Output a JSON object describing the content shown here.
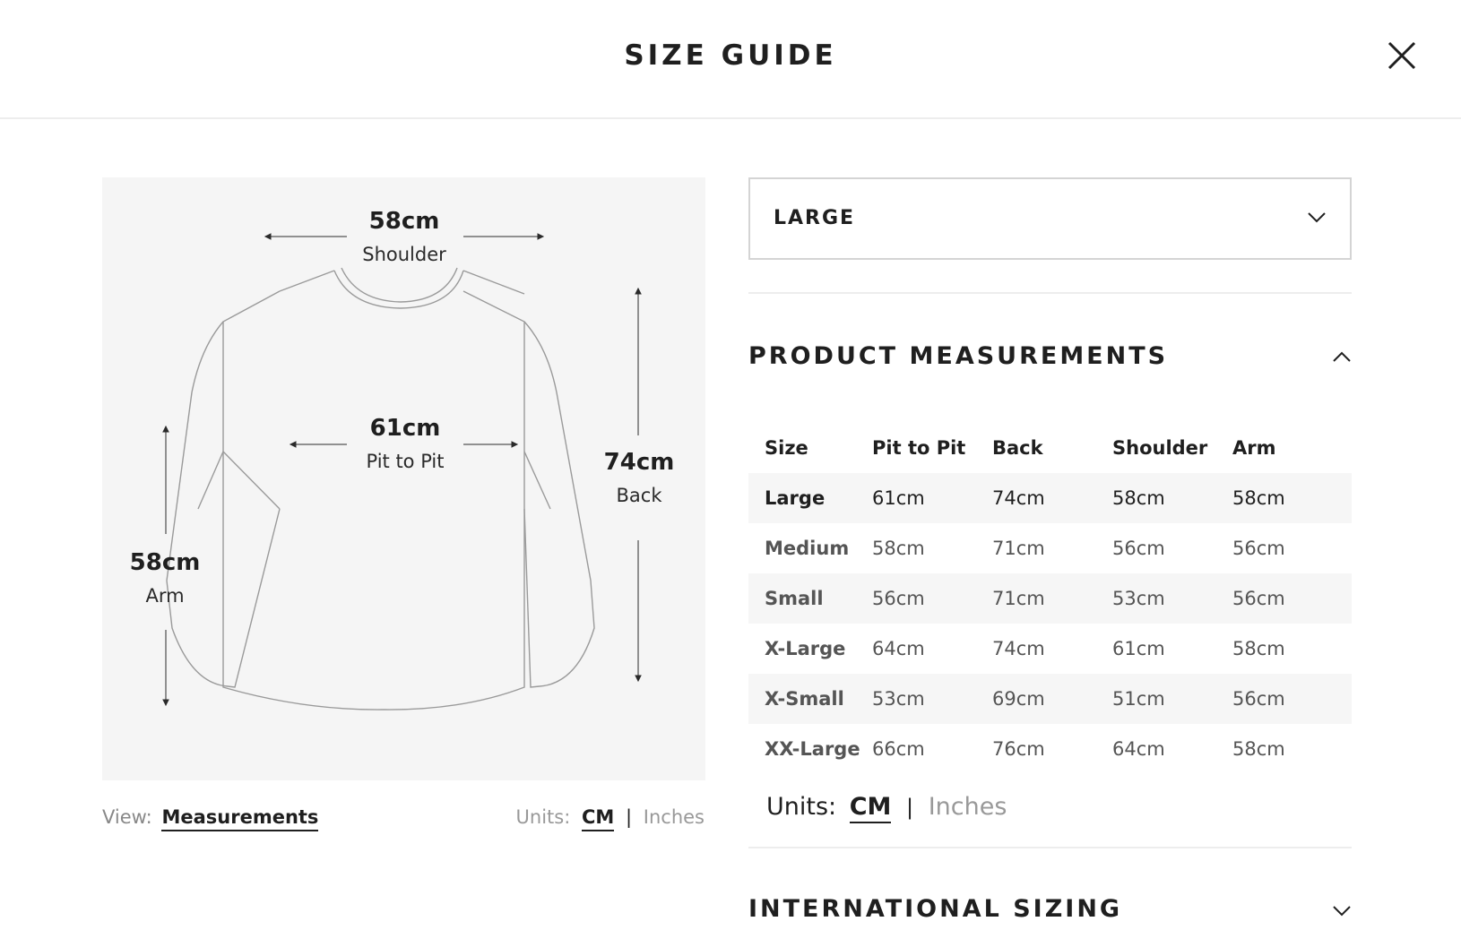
{
  "header": {
    "title": "SIZE GUIDE",
    "close_icon": "close-icon"
  },
  "diagram": {
    "shoulder": {
      "value": "58cm",
      "label": "Shoulder"
    },
    "pit": {
      "value": "61cm",
      "label": "Pit to Pit"
    },
    "back": {
      "value": "74cm",
      "label": "Back"
    },
    "arm": {
      "value": "58cm",
      "label": "Arm"
    }
  },
  "footer": {
    "view_label": "View:",
    "view_value": "Measurements",
    "units_label": "Units:",
    "unit_cm": "CM",
    "unit_sep": "|",
    "unit_in": "Inches"
  },
  "size_select": {
    "value": "LARGE",
    "chevron_icon": "chevron-down-icon"
  },
  "measurements": {
    "title": "PRODUCT MEASUREMENTS",
    "chevron_icon": "chevron-up-icon",
    "columns": [
      "Size",
      "Pit to Pit",
      "Back",
      "Shoulder",
      "Arm"
    ],
    "rows": [
      [
        "Large",
        "61cm",
        "74cm",
        "58cm",
        "58cm"
      ],
      [
        "Medium",
        "58cm",
        "71cm",
        "56cm",
        "56cm"
      ],
      [
        "Small",
        "56cm",
        "71cm",
        "53cm",
        "56cm"
      ],
      [
        "X-Large",
        "64cm",
        "74cm",
        "61cm",
        "58cm"
      ],
      [
        "X-Small",
        "53cm",
        "69cm",
        "51cm",
        "56cm"
      ],
      [
        "XX-Large",
        "66cm",
        "76cm",
        "64cm",
        "58cm"
      ]
    ],
    "units_label": "Units:",
    "unit_cm": "CM",
    "unit_sep": "|",
    "unit_in": "Inches"
  },
  "international": {
    "title": "INTERNATIONAL SIZING",
    "chevron_icon": "chevron-down-icon"
  }
}
